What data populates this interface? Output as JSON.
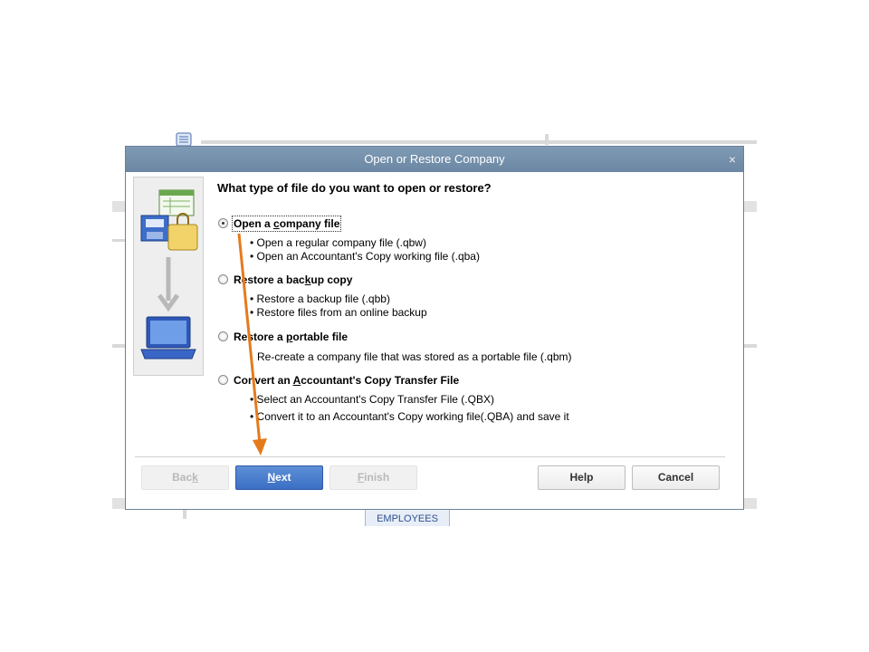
{
  "dialog": {
    "title": "Open or Restore Company",
    "close_glyph": "×",
    "question": "What type of file do you want to open or restore?",
    "options": [
      {
        "label_pre": "Open a ",
        "label_key": "c",
        "label_post": "ompany file",
        "selected": true,
        "bullets": [
          "• Open a regular company file (.qbw)",
          "• Open an Accountant's Copy working file (.qba)"
        ]
      },
      {
        "label_pre": "Restore a bac",
        "label_key": "k",
        "label_post": "up copy",
        "selected": false,
        "bullets": [
          "• Restore a backup file (.qbb)",
          "• Restore files from an online backup"
        ]
      },
      {
        "label_pre": "Restore a ",
        "label_key": "p",
        "label_post": "ortable file",
        "selected": false,
        "bullets": [
          "Re-create a company file that was stored as a portable file (.qbm)"
        ]
      },
      {
        "label_pre": "Convert an ",
        "label_key": "A",
        "label_post": "ccountant's Copy Transfer File",
        "selected": false,
        "bullets": [
          "• Select an Accountant's Copy Transfer File (.QBX)",
          "• Convert it to an Accountant's Copy working file(.QBA) and save it"
        ]
      }
    ],
    "buttons": {
      "back": {
        "pre": "Bac",
        "key": "k",
        "post": ""
      },
      "next": {
        "pre": "",
        "key": "N",
        "post": "ext"
      },
      "finish": {
        "pre": "",
        "key": "F",
        "post": "inish"
      },
      "help": "Help",
      "cancel": "Cancel"
    }
  },
  "background": {
    "employees_tab": "EMPLOYEES"
  },
  "colors": {
    "annotation_arrow": "#e57a1c",
    "primary_button": "#3b6fc4",
    "titlebar": "#7390ab"
  }
}
